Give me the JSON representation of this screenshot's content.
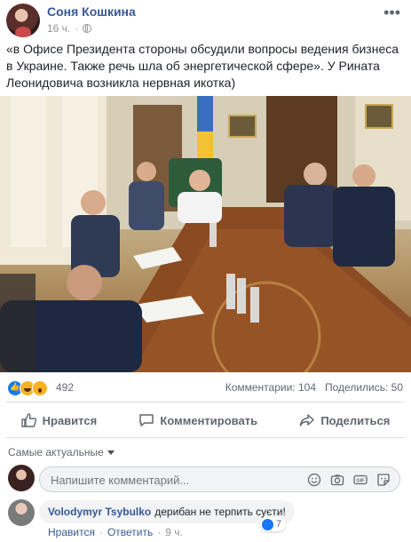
{
  "post": {
    "author": "Соня Кошкина",
    "time": "16 ч.",
    "text": "«в Офисе Президента стороны обсудили вопросы ведения бизнеса в Украине. Также речь шла об энергетической сфере». У Рината Леонидовича возникла нервная икотка)"
  },
  "reactions": {
    "count": "492",
    "comments_count": "Комментарии: 104",
    "shares_count": "Поделились: 50"
  },
  "actions": {
    "like": "Нравится",
    "comment": "Комментировать",
    "share": "Поделиться"
  },
  "comments": {
    "sort_label": "Самые актуальные",
    "input_placeholder": "Напишите комментарий...",
    "items": [
      {
        "author": "Volodymyr Tsybulko",
        "text": "дерибан не терпить суєти!",
        "reaction_count": "7",
        "like_label": "Нравится",
        "reply_label": "Ответить",
        "time": "9 ч."
      }
    ]
  },
  "icons": {
    "more": "more-icon",
    "privacy": "globe-icon",
    "like": "thumbs-up-icon",
    "comment": "speech-bubble-icon",
    "share": "share-arrow-icon",
    "emoji": "emoji-icon",
    "camera": "camera-icon",
    "gif": "gif-icon",
    "sticker": "sticker-icon"
  },
  "colors": {
    "link_blue": "#385898",
    "like_blue": "#1877f2",
    "secondary_text": "#606770"
  }
}
